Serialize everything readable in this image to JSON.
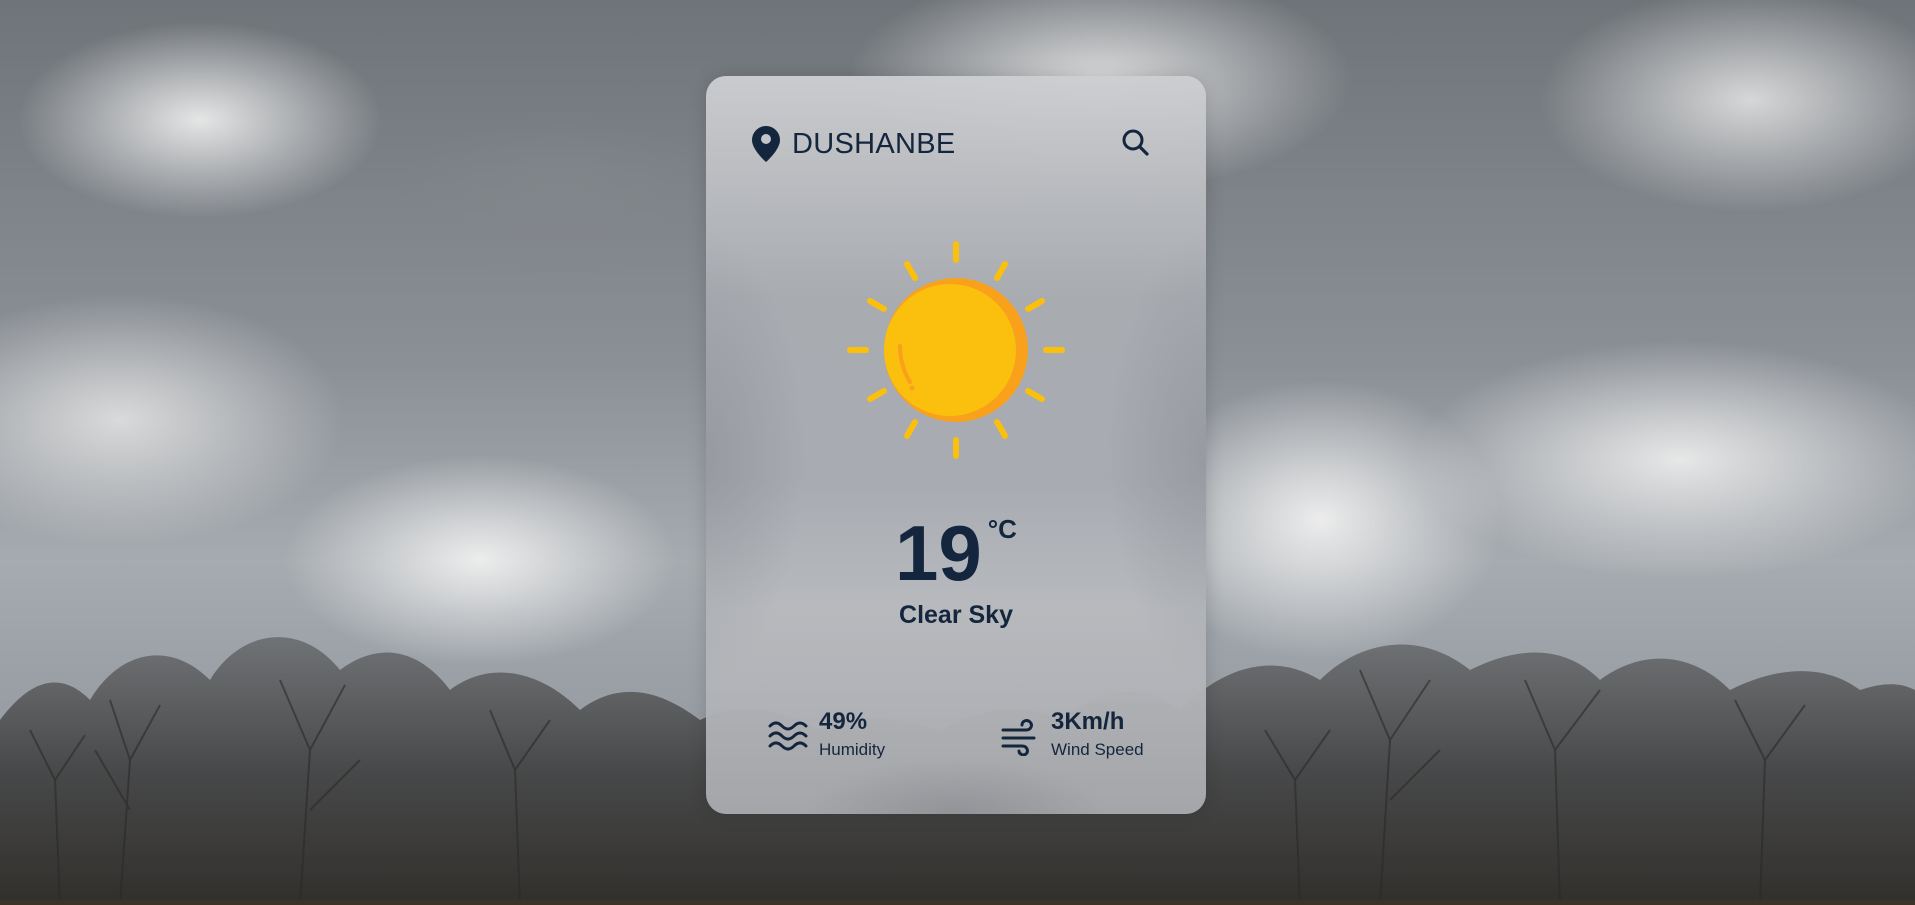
{
  "location": {
    "city": "DUSHANBE",
    "icon": "map-pin-icon"
  },
  "search": {
    "icon": "search-icon"
  },
  "weather": {
    "icon": "sun-icon",
    "temperature": "19",
    "unit": "°C",
    "description": "Clear Sky"
  },
  "stats": {
    "humidity": {
      "value": "49%",
      "label": "Humidity",
      "icon": "waves-icon"
    },
    "wind": {
      "value": "3Km/h",
      "label": "Wind Speed",
      "icon": "wind-icon"
    }
  },
  "colors": {
    "text": "#14263d",
    "sun_main": "#fbbf0e",
    "sun_shade": "#f9a11b"
  }
}
